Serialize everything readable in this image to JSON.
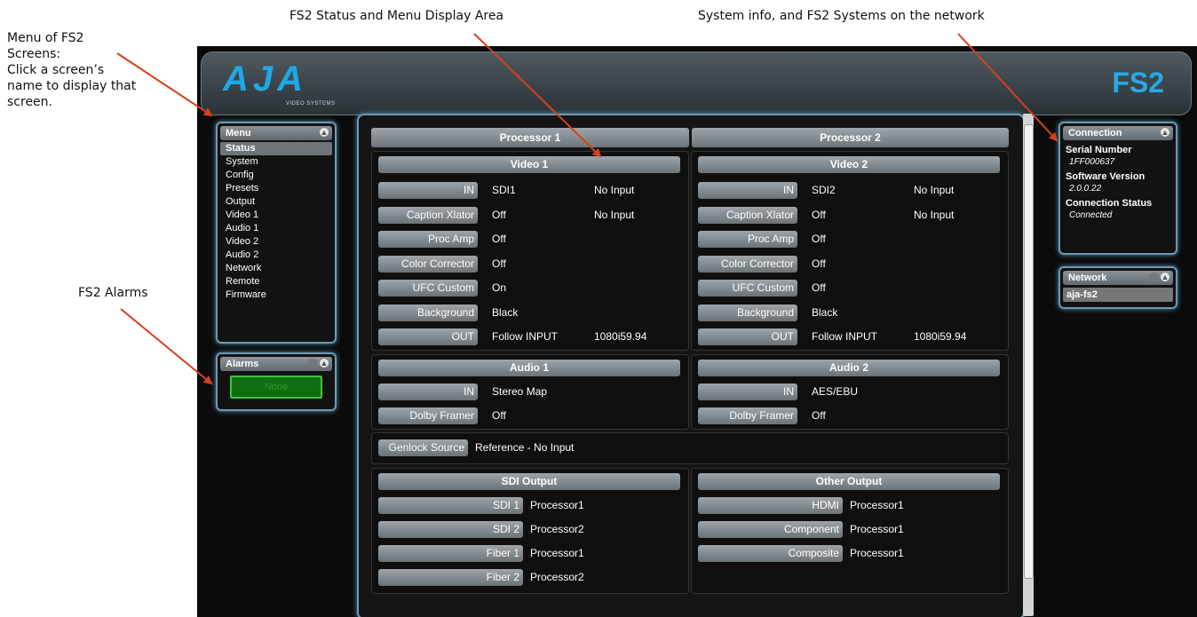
{
  "callouts": {
    "menu": [
      "Menu of FS2",
      "Screens:",
      "Click a screen’s",
      "name to display that",
      "screen."
    ],
    "alarms": "FS2 Alarms",
    "status_area": "FS2 Status and Menu Display Area",
    "system_info": "System info, and FS2 Systems on the network"
  },
  "header": {
    "logo": "AJA",
    "logo_sub": "VIDEO SYSTEMS",
    "product": "FS2"
  },
  "menu": {
    "title": "Menu",
    "items": [
      "Status",
      "System",
      "Config",
      "Presets",
      "Output",
      "Video 1",
      "Audio 1",
      "Video 2",
      "Audio 2",
      "Network",
      "Remote",
      "Firmware"
    ],
    "active": "Status"
  },
  "alarms": {
    "title": "Alarms",
    "button": "None"
  },
  "connection": {
    "title": "Connection",
    "serial_label": "Serial Number",
    "serial_value": "1FF000637",
    "software_label": "Software Version",
    "software_value": "2.0.0.22",
    "status_label": "Connection Status",
    "status_value": "Connected"
  },
  "network": {
    "title": "Network",
    "item": "aja-fs2"
  },
  "status": {
    "proc1": "Processor 1",
    "proc2": "Processor 2",
    "video1": {
      "title": "Video 1",
      "rows": [
        [
          "IN",
          "SDI1",
          "No Input"
        ],
        [
          "Caption Xlator",
          "Off",
          "No Input"
        ],
        [
          "Proc Amp",
          "Off",
          ""
        ],
        [
          "Color Corrector",
          "Off",
          ""
        ],
        [
          "UFC Custom",
          "On",
          ""
        ],
        [
          "Background",
          "Black",
          ""
        ],
        [
          "OUT",
          "Follow INPUT",
          "1080i59.94"
        ]
      ]
    },
    "video2": {
      "title": "Video 2",
      "rows": [
        [
          "IN",
          "SDI2",
          "No Input"
        ],
        [
          "Caption Xlator",
          "Off",
          "No Input"
        ],
        [
          "Proc Amp",
          "Off",
          ""
        ],
        [
          "Color Corrector",
          "Off",
          ""
        ],
        [
          "UFC Custom",
          "Off",
          ""
        ],
        [
          "Background",
          "Black",
          ""
        ],
        [
          "OUT",
          "Follow INPUT",
          "1080i59.94"
        ]
      ]
    },
    "audio1": {
      "title": "Audio 1",
      "rows": [
        [
          "IN",
          "Stereo Map"
        ],
        [
          "Dolby Framer",
          "Off"
        ]
      ]
    },
    "audio2": {
      "title": "Audio 2",
      "rows": [
        [
          "IN",
          "AES/EBU"
        ],
        [
          "Dolby Framer",
          "Off"
        ]
      ]
    },
    "genlock": {
      "label": "Genlock Source",
      "value": "Reference - No Input"
    },
    "sdi_output": {
      "title": "SDI Output",
      "rows": [
        [
          "SDI 1",
          "Processor1"
        ],
        [
          "SDI 2",
          "Processor2"
        ],
        [
          "Fiber 1",
          "Processor1"
        ],
        [
          "Fiber 2",
          "Processor2"
        ]
      ]
    },
    "other_output": {
      "title": "Other Output",
      "rows": [
        [
          "HDMI",
          "Processor1"
        ],
        [
          "Component",
          "Processor1"
        ],
        [
          "Composite",
          "Processor1"
        ]
      ]
    }
  },
  "colors": {
    "accent": "#27a9e6",
    "panel_border": "#6e98b4",
    "arrow": "#d6401e",
    "alarm_green": "#0f6e10"
  }
}
